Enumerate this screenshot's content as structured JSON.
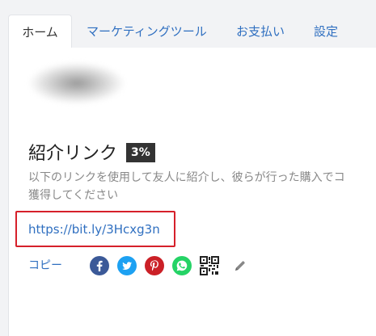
{
  "tabs": [
    {
      "label": "ホーム",
      "active": true
    },
    {
      "label": "マーケティングツール",
      "active": false
    },
    {
      "label": "お支払い",
      "active": false
    },
    {
      "label": "設定",
      "active": false
    }
  ],
  "referral": {
    "title": "紹介リンク",
    "percent": "3%",
    "description_line1": "以下のリンクを使用して友人に紹介し、彼らが行った購入でコ",
    "description_line2": "獲得してください",
    "link": "https://bit.ly/3Hcxg3n",
    "copy_label": "コピー"
  },
  "share_icons": [
    "facebook-icon",
    "twitter-icon",
    "pinterest-icon",
    "whatsapp-icon",
    "qr-code-icon",
    "edit-pencil-icon"
  ],
  "colors": {
    "accent_link": "#2f6fc0",
    "highlight_border": "#d6202a",
    "badge_bg": "#333333",
    "facebook": "#3b5998",
    "twitter": "#1da1f2",
    "pinterest": "#cb2027",
    "whatsapp": "#25d366"
  }
}
